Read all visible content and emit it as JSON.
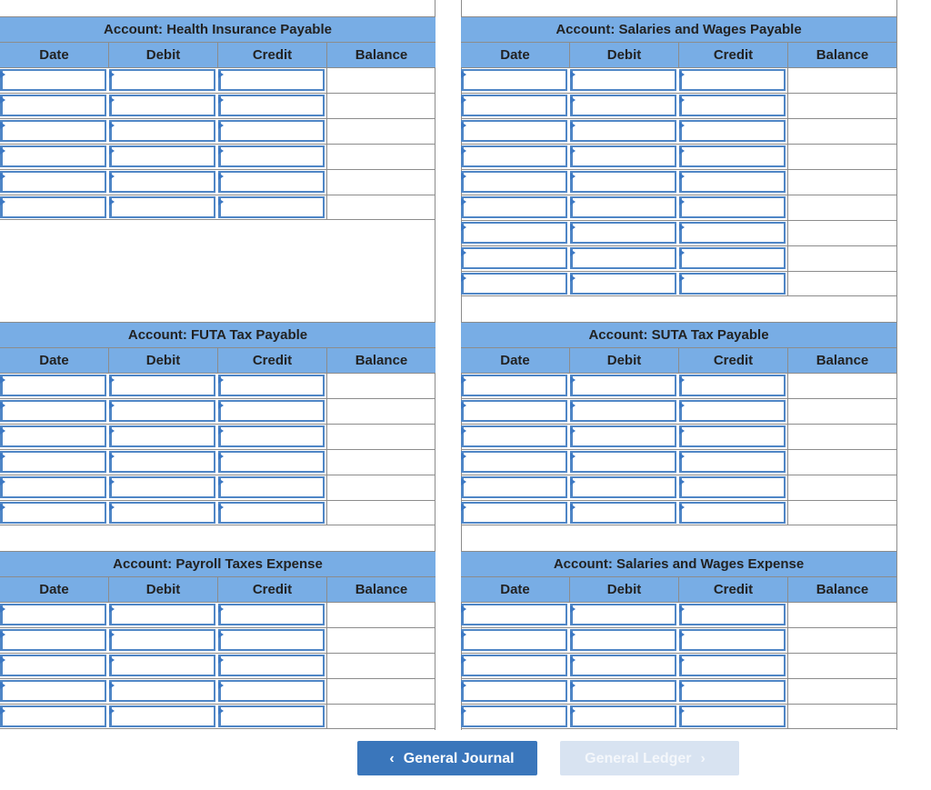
{
  "columns": [
    "Date",
    "Debit",
    "Credit",
    "Balance"
  ],
  "accounts": [
    {
      "title": "Account: Health Insurance Payable",
      "rows": 6
    },
    {
      "title": "Account: Salaries and Wages Payable",
      "rows": 9
    },
    {
      "title": "Account: FUTA Tax Payable",
      "rows": 6
    },
    {
      "title": "Account: SUTA Tax Payable",
      "rows": 6
    },
    {
      "title": "Account: Payroll Taxes Expense",
      "rows": 5
    },
    {
      "title": "Account: Salaries and Wages Expense",
      "rows": 5
    }
  ],
  "nav": {
    "prev_label": "General Journal",
    "next_label": "General Ledger",
    "prev_icon": "chevron-left-icon",
    "next_icon": "chevron-right-icon",
    "next_enabled": false
  },
  "colors": {
    "header_bg": "#78ade5",
    "input_border": "#4f86c6",
    "primary_button": "#3a76bb",
    "disabled_button": "#d8e3f1"
  }
}
